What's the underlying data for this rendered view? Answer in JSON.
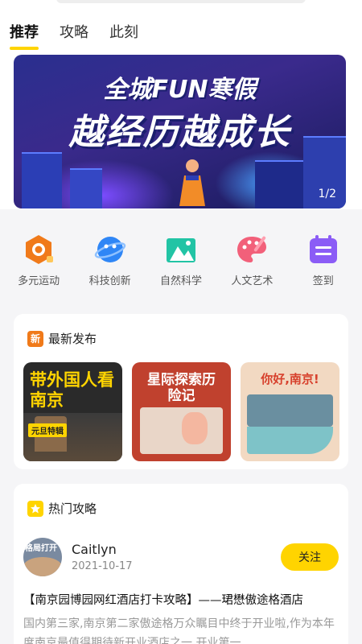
{
  "tabs": [
    {
      "label": "推荐",
      "active": true
    },
    {
      "label": "攻略",
      "active": false
    },
    {
      "label": "此刻",
      "active": false
    }
  ],
  "banner": {
    "title_line1": "全城FUN寒假",
    "title_line2": "越经历越成长",
    "counter": "1/2"
  },
  "categories": [
    {
      "label": "多元运动",
      "icon": "sports-icon",
      "color": "#f07a1a"
    },
    {
      "label": "科技创新",
      "icon": "planet-icon",
      "color": "#2f86f6"
    },
    {
      "label": "自然科学",
      "icon": "mountain-icon",
      "color": "#22c4a5"
    },
    {
      "label": "人文艺术",
      "icon": "palette-icon",
      "color": "#f2607a"
    },
    {
      "label": "签到",
      "icon": "calendar-icon",
      "color": "#8b5cf6"
    }
  ],
  "latest": {
    "badge": "新",
    "title": "最新发布",
    "items": [
      {
        "title": "带外国人看南京",
        "tag": "元旦特辑",
        "color": "#2a2a2a"
      },
      {
        "title": "星际探索历险记",
        "color": "#c0412e"
      },
      {
        "title": "你好,南京!",
        "color": "#f2d9c2"
      }
    ]
  },
  "hot": {
    "title": "热门攻略",
    "post": {
      "avatar_text": "格局打开",
      "user": "Caitlyn",
      "date": "2021-10-17",
      "follow_label": "关注",
      "title": "【南京园博园网红酒店打卡攻略】——珺懋傲途格酒店",
      "body": "国内第三家,南京第二家傲途格万众瞩目中终于开业啦,作为本年度南京最值得期待新开业酒店之一,开业第一"
    }
  },
  "colors": {
    "accent": "#ffd400",
    "background": "#f5f5f7"
  }
}
